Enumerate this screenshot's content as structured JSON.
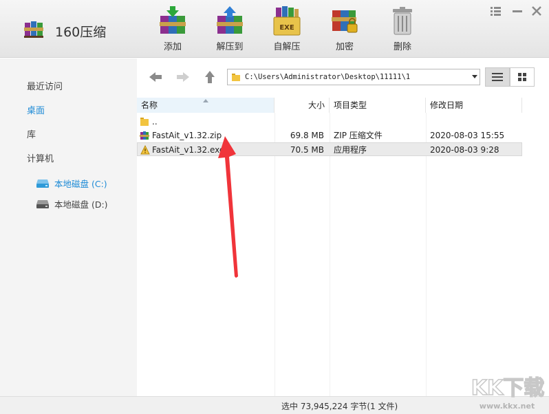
{
  "app": {
    "title": "160压缩",
    "logo_icon": "winrar-books-icon"
  },
  "toolbar": [
    {
      "key": "add",
      "label": "添加",
      "icon": "add-archive-icon"
    },
    {
      "key": "extract",
      "label": "解压到",
      "icon": "extract-to-icon"
    },
    {
      "key": "selfextract",
      "label": "自解压",
      "icon": "self-extract-exe-icon",
      "badge": "EXE"
    },
    {
      "key": "encrypt",
      "label": "加密",
      "icon": "encrypt-lock-icon"
    },
    {
      "key": "delete",
      "label": "删除",
      "icon": "trash-icon"
    }
  ],
  "window_controls": {
    "menu_icon": "hamburger-icon",
    "close_icon": "close-icon"
  },
  "sidebar": {
    "items": [
      {
        "label": "最近访问",
        "active": false
      },
      {
        "label": "桌面",
        "active": true
      },
      {
        "label": "库",
        "active": false
      },
      {
        "label": "计算机",
        "active": false
      }
    ],
    "drives": [
      {
        "label": "本地磁盘 (C:)",
        "active": true
      },
      {
        "label": "本地磁盘 (D:)",
        "active": false
      }
    ]
  },
  "nav": {
    "path": "C:\\Users\\Administrator\\Desktop\\11111\\1",
    "back_icon": "arrow-left-icon",
    "forward_icon": "arrow-right-icon",
    "up_icon": "arrow-up-icon"
  },
  "columns": {
    "name": "名称",
    "size": "大小",
    "type": "项目类型",
    "date": "修改日期"
  },
  "files": [
    {
      "name": "..",
      "size": "",
      "type": "",
      "date": "",
      "icon": "folder-icon"
    },
    {
      "name": "FastAit_v1.32.zip",
      "size": "69.8 MB",
      "type": "ZIP 压缩文件",
      "date": "2020-08-03 15:55",
      "icon": "zip-archive-icon"
    },
    {
      "name": "FastAit_v1.32.exe",
      "size": "70.5 MB",
      "type": "应用程序",
      "date": "2020-08-03 9:28",
      "icon": "exe-warning-icon"
    }
  ],
  "status": {
    "text": "选中  73,945,224 字节(1 文件)"
  },
  "watermark": {
    "logo": "KK下载",
    "url": "www.kkx.net"
  },
  "colors": {
    "accent": "#1e8bd6",
    "arrow": "#f0343a"
  }
}
